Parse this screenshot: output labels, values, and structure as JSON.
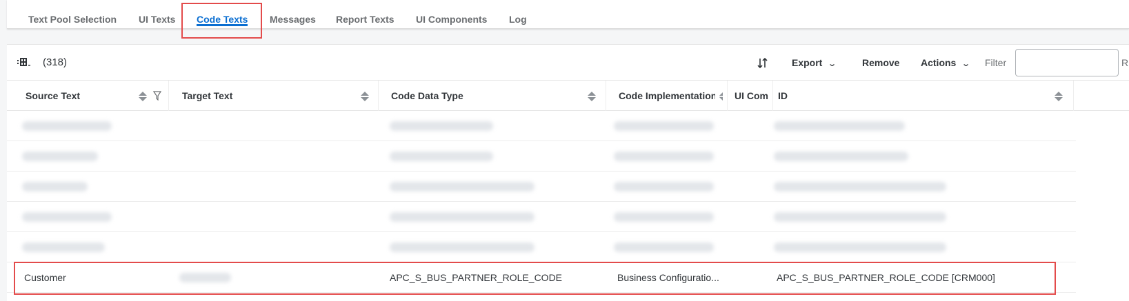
{
  "tabs": [
    {
      "label": "Text Pool Selection",
      "active": false
    },
    {
      "label": "UI Texts",
      "active": false
    },
    {
      "label": "Code Texts",
      "active": true
    },
    {
      "label": "Messages",
      "active": false
    },
    {
      "label": "Report Texts",
      "active": false
    },
    {
      "label": "UI Components",
      "active": false
    },
    {
      "label": "Log",
      "active": false
    }
  ],
  "toolbar": {
    "count": "(318)",
    "export_label": "Export",
    "remove_label": "Remove",
    "actions_label": "Actions",
    "filter_label": "Filter",
    "filter_value": "",
    "clipped_label": "R"
  },
  "columns": [
    {
      "label": "Source Text"
    },
    {
      "label": "Target Text"
    },
    {
      "label": "Code Data Type"
    },
    {
      "label": "Code Implementation"
    },
    {
      "label": "UI Com"
    },
    {
      "label": "ID"
    }
  ],
  "rows": [
    {
      "source_text": "Customer",
      "target_text": "",
      "code_data_type": "APC_S_BUS_PARTNER_ROLE_CODE",
      "code_implementation": "Business Configuratio...",
      "ui_component": "",
      "id": "APC_S_BUS_PARTNER_ROLE_CODE [CRM000]"
    }
  ],
  "colors": {
    "accent": "#0a6ed1",
    "highlight": "#e34b4b"
  }
}
